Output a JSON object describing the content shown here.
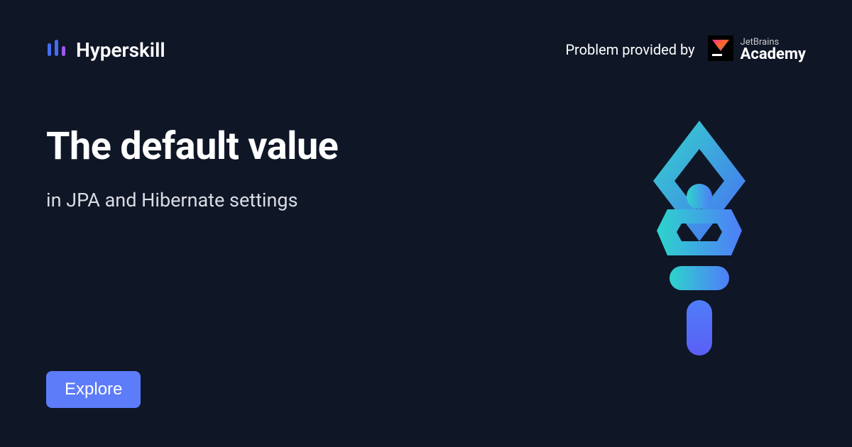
{
  "brand": {
    "name": "Hyperskill"
  },
  "provider": {
    "label": "Problem provided by",
    "partner_top": "JetBrains",
    "partner_main": "Academy"
  },
  "content": {
    "title": "The default value",
    "subtitle": "in JPA and Hibernate settings"
  },
  "cta": {
    "explore": "Explore"
  }
}
